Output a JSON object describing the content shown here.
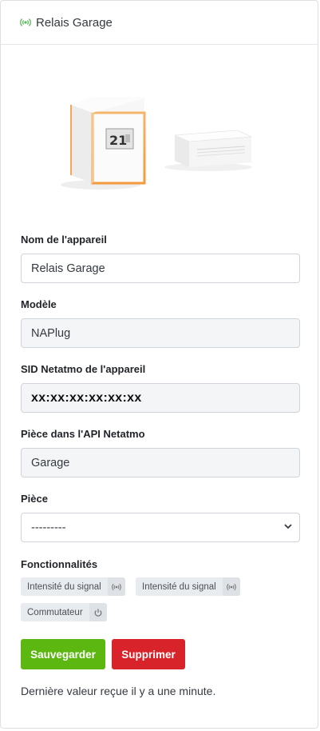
{
  "header": {
    "title": "Relais Garage",
    "icon": "signal-icon",
    "accent": "#5cb85c"
  },
  "form": {
    "device_name_label": "Nom de l'appareil",
    "device_name_value": "Relais Garage",
    "model_label": "Modèle",
    "model_value": "NAPlug",
    "sid_label": "SID Netatmo de l'appareil",
    "sid_value": "xx:xx:xx:xx:xx:xx",
    "api_room_label": "Pièce dans l'API Netatmo",
    "api_room_value": "Garage",
    "room_label": "Pièce",
    "room_value": "---------",
    "features_label": "Fonctionnalités",
    "features": [
      {
        "label": "Intensité du signal",
        "icon": "signal-icon"
      },
      {
        "label": "Intensité du signal",
        "icon": "signal-icon"
      },
      {
        "label": "Commutateur",
        "icon": "power-icon"
      }
    ]
  },
  "thermostat_display": "21",
  "actions": {
    "save_label": "Sauvegarder",
    "save_color": "#5cb811",
    "delete_label": "Supprimer",
    "delete_color": "#d9232a"
  },
  "status_note": "Dernière valeur reçue il y a une minute."
}
